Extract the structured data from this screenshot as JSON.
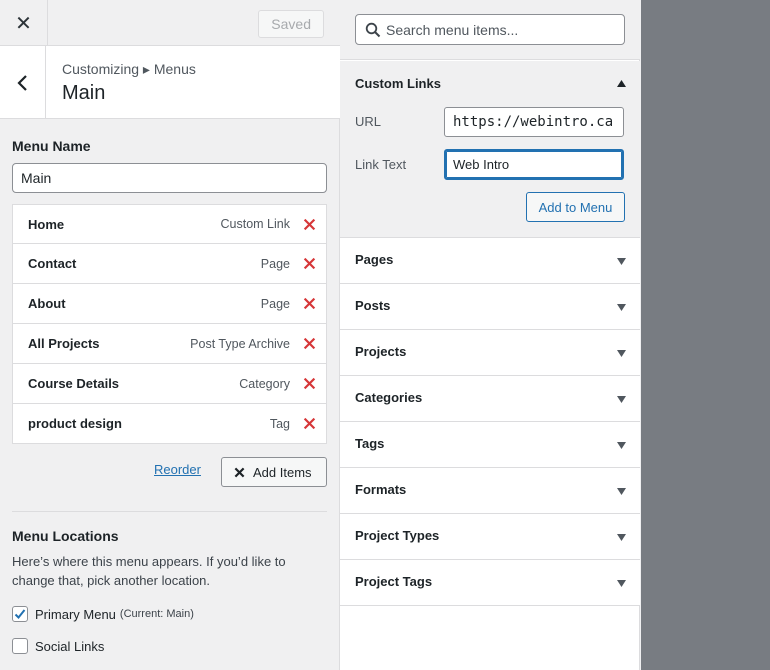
{
  "topbar": {
    "saved_label": "Saved"
  },
  "header": {
    "breadcrumb": "Customizing ▸ Menus",
    "title": "Main"
  },
  "menu_name": {
    "label": "Menu Name",
    "value": "Main"
  },
  "menu_items": [
    {
      "title": "Home",
      "type": "Custom Link"
    },
    {
      "title": "Contact",
      "type": "Page"
    },
    {
      "title": "About",
      "type": "Page"
    },
    {
      "title": "All Projects",
      "type": "Post Type Archive"
    },
    {
      "title": "Course Details",
      "type": "Category"
    },
    {
      "title": "product design",
      "type": "Tag"
    }
  ],
  "actions": {
    "reorder_label": "Reorder",
    "add_items_label": "Add Items"
  },
  "locations": {
    "title": "Menu Locations",
    "description": "Here’s where this menu appears. If you’d like to change that, pick another location.",
    "items": [
      {
        "label": "Primary Menu",
        "note": "(Current: Main)",
        "checked": true
      },
      {
        "label": "Social Links",
        "note": "",
        "checked": false
      }
    ]
  },
  "search": {
    "placeholder": "Search menu items..."
  },
  "custom_links": {
    "title": "Custom Links",
    "url_label": "URL",
    "url_value": "https://webintro.ca",
    "link_text_label": "Link Text",
    "link_text_value": "Web Intro",
    "add_button": "Add to Menu"
  },
  "sections": [
    "Pages",
    "Posts",
    "Projects",
    "Categories",
    "Tags",
    "Formats",
    "Project Types",
    "Project Tags"
  ],
  "colors": {
    "accent": "#2271b1",
    "delete": "#d63638",
    "preview_bg": "#787c82"
  }
}
